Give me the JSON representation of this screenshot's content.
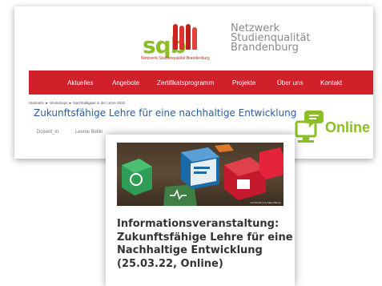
{
  "header": {
    "logo_text": "sqb",
    "logo_subtitle": "Netzwerk Studienqualität Brandenburg",
    "network_name_lines": [
      "Netzwerk",
      "Studienqualität",
      "Brandenburg"
    ]
  },
  "nav": {
    "items": [
      "Aktuelles",
      "Angebote",
      "Zertifikatsprogramm",
      "Projekte",
      "Über uns",
      "Kontakt"
    ]
  },
  "breadcrumb": "Startseite ► Workshops ► Nachhaltigkeit in der Lehre 2022",
  "page_title": "Zukunftsfähige Lehre für eine nachhaltige Entwicklung",
  "dozent": {
    "label": "Dozent_in:",
    "name": "Leonie Bellin"
  },
  "online_badge": {
    "text": "Online"
  },
  "card": {
    "image_caption": "CC BY-NC 2.0 | https://flic.kr/",
    "title_lines": [
      "Informationsveranstaltung:",
      "Zukunftsfähige Lehre für eine",
      "Nachhaltige Entwicklung",
      "(25.03.22, Online)"
    ]
  },
  "colors": {
    "nav_red": "#d0202a",
    "brand_green": "#8cbf26",
    "title_blue": "#2a5d9f"
  }
}
